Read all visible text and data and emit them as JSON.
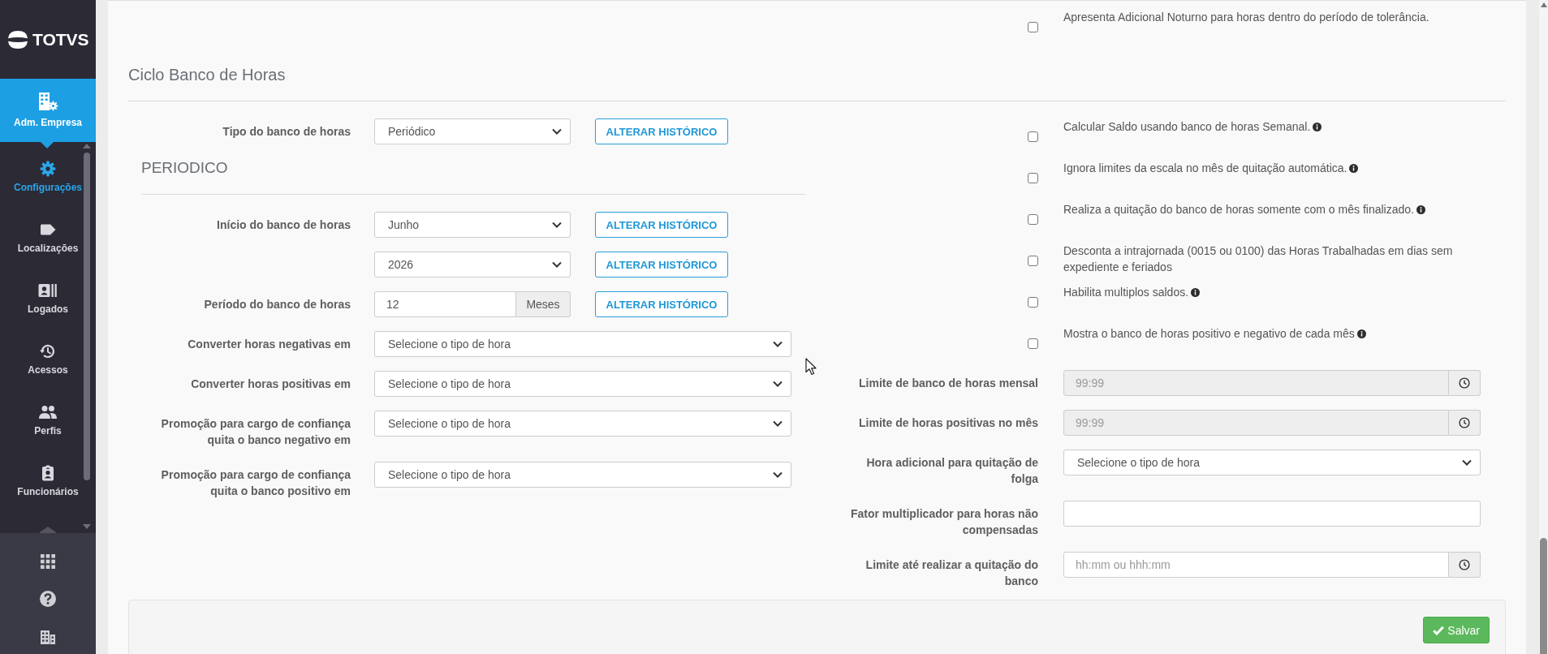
{
  "sidebar": {
    "logo": "TOTVS",
    "module": {
      "label": "Adm. Empresa",
      "selected": true
    },
    "items": [
      {
        "label": "Configurações",
        "selected": true
      },
      {
        "label": "Localizações",
        "selected": false
      },
      {
        "label": "Logados",
        "selected": false
      },
      {
        "label": "Acessos",
        "selected": false
      },
      {
        "label": "Perfis",
        "selected": false
      },
      {
        "label": "Funcionários",
        "selected": false
      }
    ]
  },
  "top_options": [
    {
      "label": "Apresenta Adicional Noturno para horas dentro do período de tolerância.",
      "checked": false,
      "info": false
    }
  ],
  "section": {
    "title": "Ciclo Banco de Horas"
  },
  "left_rows": [
    {
      "kind": "select",
      "label": "Tipo do banco de horas",
      "value": "Periódico",
      "button": "ALTERAR HISTÓRICO"
    },
    {
      "kind": "heading",
      "title": "PERIODICO"
    },
    {
      "kind": "select",
      "label": "Início do banco de horas",
      "value": "Junho",
      "button": "ALTERAR HISTÓRICO"
    },
    {
      "kind": "select",
      "value": "2026",
      "button": "ALTERAR HISTÓRICO"
    },
    {
      "kind": "unit_input",
      "label": "Período do banco de horas",
      "value": "12",
      "unit": "Meses",
      "button": "ALTERAR HISTÓRICO"
    },
    {
      "kind": "select",
      "label": "Converter horas negativas em",
      "value": "Selecione o tipo de hora"
    },
    {
      "kind": "select",
      "label": "Converter horas positivas em",
      "value": "Selecione o tipo de hora"
    },
    {
      "kind": "select",
      "label": "Promoção para cargo de confiança quita o banco negativo em",
      "value": "Selecione o tipo de hora"
    },
    {
      "kind": "select",
      "label": "Promoção para cargo de confiança quita o banco positivo em",
      "value": "Selecione o tipo de hora"
    }
  ],
  "right_options": [
    {
      "label": "Calcular Saldo usando banco de horas Semanal.",
      "checked": false,
      "info": true
    },
    {
      "label": "Ignora limites da escala no mês de quitação automática.",
      "checked": false,
      "info": true
    },
    {
      "label": "Realiza a quitação do banco de horas somente com o mês finalizado.",
      "checked": false,
      "info": true
    },
    {
      "label": "Desconta a intrajornada (0015 ou 0100) das Horas Trabalhadas em dias sem expediente e feriados",
      "checked": false,
      "info": false
    },
    {
      "label": "Habilita multiplos saldos.",
      "checked": false,
      "info": true
    },
    {
      "label": "Mostra o banco de horas positivo e negativo de cada mês",
      "checked": false,
      "info": true
    }
  ],
  "right_rows": [
    {
      "kind": "time_input",
      "label": "Limite de banco de horas mensal",
      "placeholder": "99:99",
      "disabled": true
    },
    {
      "kind": "time_input",
      "label": "Limite de horas positivas no mês",
      "placeholder": "99:99",
      "disabled": true
    },
    {
      "kind": "select",
      "label": "Hora adicional para quitação de folga",
      "value": "Selecione o tipo de hora"
    },
    {
      "kind": "text_input",
      "label": "Fator multiplicador para horas não compensadas"
    },
    {
      "kind": "time_input",
      "label": "Limite até realizar a quitação do banco",
      "placeholder": "hh:mm ou hhh:mm",
      "disabled": false
    }
  ],
  "footer": {
    "save_button": "Salvar"
  }
}
